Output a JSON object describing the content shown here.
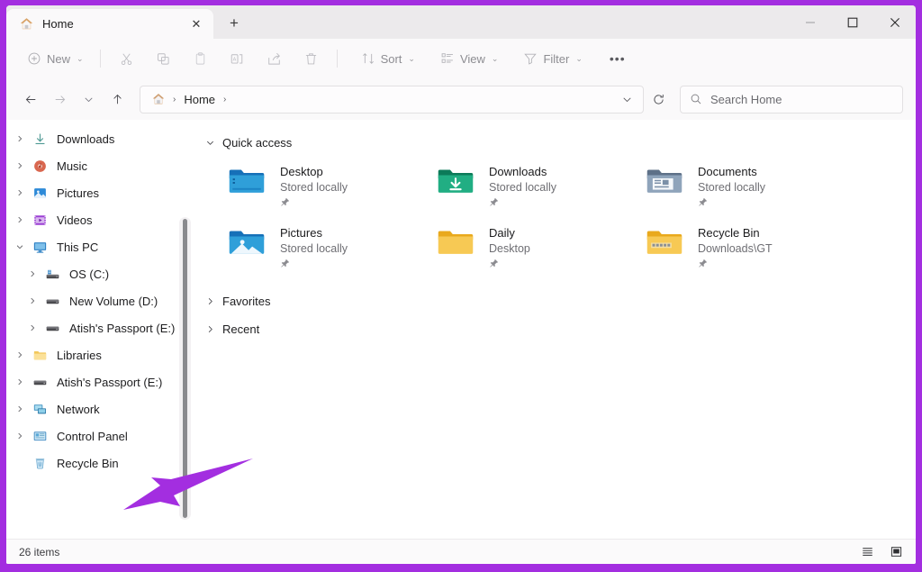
{
  "window": {
    "accent_border_color": "#a32ee0",
    "titlebar_bg": "#eceaec",
    "controls": {
      "minimize_label": "–",
      "maximize_label": "□",
      "close_label": "✕"
    }
  },
  "tabs": [
    {
      "title": "Home",
      "icon": "home-icon",
      "close_label": "✕",
      "active": true
    }
  ],
  "new_tab_label": "+",
  "toolbar": {
    "new_label": "New",
    "new_icon": "plus-circle-icon",
    "cut_icon": "scissors-icon",
    "copy_icon": "copy-icon",
    "paste_icon": "clipboard-icon",
    "rename_icon": "rename-icon",
    "share_icon": "share-icon",
    "delete_icon": "trash-icon",
    "sort_label": "Sort",
    "sort_icon": "sort-icon",
    "view_label": "View",
    "view_icon": "view-icon",
    "filter_label": "Filter",
    "filter_icon": "filter-icon",
    "more_label": "•••",
    "chevron": "⌄"
  },
  "navigation": {
    "back_icon": "arrow-left-icon",
    "forward_icon": "arrow-right-icon",
    "recent_icon": "chevron-down-icon",
    "up_icon": "arrow-up-icon",
    "breadcrumb": {
      "home_icon": "home-icon",
      "items": [
        "Home"
      ],
      "separator": "›",
      "dropdown_chevron": "⌄"
    },
    "refresh_icon": "refresh-icon"
  },
  "search": {
    "placeholder": "Search Home",
    "value": "",
    "icon": "search-icon"
  },
  "sidebar": {
    "items": [
      {
        "label": "Downloads",
        "icon": "downloads-icon",
        "expander": "›",
        "indent": 0
      },
      {
        "label": "Music",
        "icon": "music-icon",
        "expander": "›",
        "indent": 0
      },
      {
        "label": "Pictures",
        "icon": "pictures-icon",
        "expander": "›",
        "indent": 0
      },
      {
        "label": "Videos",
        "icon": "videos-icon",
        "expander": "›",
        "indent": 0
      },
      {
        "label": "This PC",
        "icon": "this-pc-icon",
        "expander": "⌄",
        "indent": 0,
        "expanded": true
      },
      {
        "label": "OS (C:)",
        "icon": "drive-os-icon",
        "expander": "›",
        "indent": 1
      },
      {
        "label": "New Volume (D:)",
        "icon": "drive-icon",
        "expander": "›",
        "indent": 1
      },
      {
        "label": "Atish's Passport  (E:)",
        "icon": "drive-icon",
        "expander": "›",
        "indent": 1
      },
      {
        "label": "Libraries",
        "icon": "libraries-icon",
        "expander": "›",
        "indent": 0
      },
      {
        "label": "Atish's Passport  (E:)",
        "icon": "drive-icon",
        "expander": "›",
        "indent": 0
      },
      {
        "label": "Network",
        "icon": "network-icon",
        "expander": "›",
        "indent": 0
      },
      {
        "label": "Control Panel",
        "icon": "control-panel-icon",
        "expander": "›",
        "indent": 0
      },
      {
        "label": "Recycle Bin",
        "icon": "recycle-bin-icon",
        "expander": "",
        "indent": 0
      }
    ]
  },
  "content": {
    "quick_access": {
      "title": "Quick access",
      "chevron": "⌄",
      "items": [
        {
          "name": "Desktop",
          "sub": "Stored locally",
          "icon": "folder-desktop-icon",
          "pinned": true
        },
        {
          "name": "Downloads",
          "sub": "Stored locally",
          "icon": "folder-downloads-icon",
          "pinned": true
        },
        {
          "name": "Documents",
          "sub": "Stored locally",
          "icon": "folder-documents-icon",
          "pinned": true
        },
        {
          "name": "Pictures",
          "sub": "Stored locally",
          "icon": "folder-pictures-icon",
          "pinned": true
        },
        {
          "name": "Daily",
          "sub": "Desktop",
          "icon": "folder-yellow-icon",
          "pinned": true
        },
        {
          "name": "Recycle Bin",
          "sub": "Downloads\\GT",
          "icon": "folder-recycle-icon",
          "pinned": false
        }
      ],
      "pin_glyph": "📌"
    },
    "favorites": {
      "title": "Favorites",
      "chevron": "›"
    },
    "recent": {
      "title": "Recent",
      "chevron": "›"
    }
  },
  "statusbar": {
    "item_count": "26 items",
    "details_view_icon": "details-view-icon",
    "large_icons_view_icon": "large-icons-view-icon"
  },
  "annotation": {
    "arrow_color": "#a32ee0",
    "points_to": "Recycle Bin"
  }
}
